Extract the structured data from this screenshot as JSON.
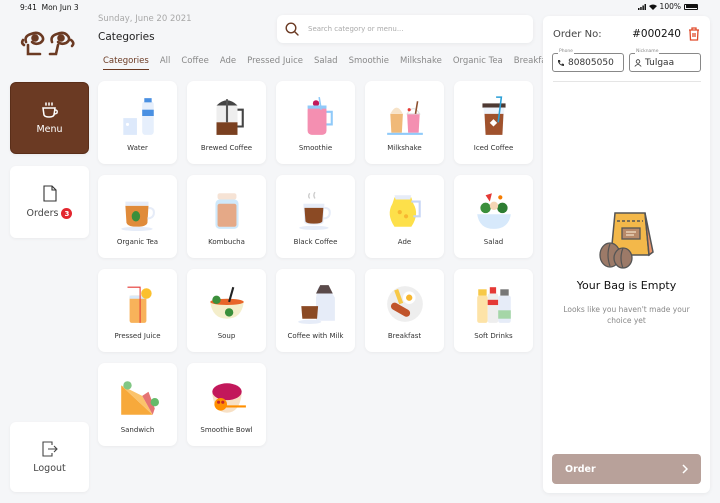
{
  "status_bar": {
    "time": "9:41",
    "date": "Mon Jun 3",
    "battery": "100%"
  },
  "header": {
    "date": "Sunday, June 20 2021",
    "title": "Categories",
    "search_placeholder": "Search category or menu..."
  },
  "sidebar": {
    "menu_label": "Menu",
    "orders_label": "Orders",
    "orders_count": "3",
    "logout_label": "Logout"
  },
  "tabs": [
    {
      "label": "Categories",
      "active": true
    },
    {
      "label": "All"
    },
    {
      "label": "Coffee"
    },
    {
      "label": "Ade"
    },
    {
      "label": "Pressed Juice"
    },
    {
      "label": "Salad"
    },
    {
      "label": "Smoothie"
    },
    {
      "label": "Milkshake"
    },
    {
      "label": "Organic Tea"
    },
    {
      "label": "Breakfast"
    }
  ],
  "categories": [
    {
      "label": "Water",
      "icon": "water-icon"
    },
    {
      "label": "Brewed Coffee",
      "icon": "french-press-icon"
    },
    {
      "label": "Smoothie",
      "icon": "smoothie-jar-icon"
    },
    {
      "label": "Milkshake",
      "icon": "milkshake-icon"
    },
    {
      "label": "Iced Coffee",
      "icon": "iced-coffee-icon"
    },
    {
      "label": "Organic Tea",
      "icon": "tea-cup-icon"
    },
    {
      "label": "Kombucha",
      "icon": "kombucha-jar-icon"
    },
    {
      "label": "Black Coffee",
      "icon": "coffee-cup-icon"
    },
    {
      "label": "Ade",
      "icon": "lemonade-pitcher-icon"
    },
    {
      "label": "Salad",
      "icon": "salad-bowl-icon"
    },
    {
      "label": "Pressed Juice",
      "icon": "juice-glass-icon"
    },
    {
      "label": "Soup",
      "icon": "soup-bowl-icon"
    },
    {
      "label": "Coffee with Milk",
      "icon": "coffee-milk-icon"
    },
    {
      "label": "Breakfast",
      "icon": "breakfast-plate-icon"
    },
    {
      "label": "Soft Drinks",
      "icon": "soft-drinks-icon"
    },
    {
      "label": "Sandwich",
      "icon": "sandwich-icon"
    },
    {
      "label": "Smoothie Bowl",
      "icon": "smoothie-bowl-icon"
    }
  ],
  "order": {
    "label": "Order No:",
    "number": "#000240",
    "phone_legend": "Phone",
    "phone": "80805050",
    "nickname_legend": "Nickname",
    "nickname": "Tulgaa",
    "empty_title": "Your Bag is Empty",
    "empty_subtitle": "Looks like you haven't made your choice yet",
    "button_label": "Order"
  },
  "colors": {
    "accent": "#6b3a23",
    "order_button": "#b8a19a",
    "badge": "#e3262e",
    "trash": "#e04a2a"
  }
}
